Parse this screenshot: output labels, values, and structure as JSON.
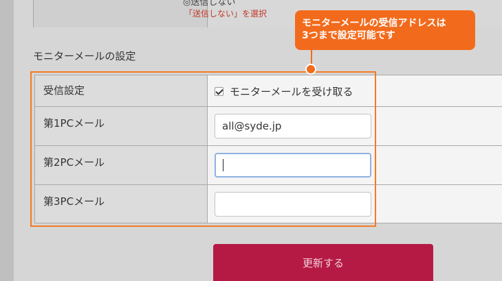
{
  "top_section": {
    "radio_text": "◎送信しない",
    "note": "「送信しない」を選択"
  },
  "section_title": "モニターメールの設定",
  "rows": [
    {
      "label": "受信設定",
      "checkbox_label": "モニターメールを受け取る",
      "checked": true
    },
    {
      "label": "第1PCメール",
      "value": "all@syde.jp",
      "placeholder": ""
    },
    {
      "label": "第2PCメール",
      "value": "",
      "placeholder": ""
    },
    {
      "label": "第3PCメール",
      "value": "",
      "placeholder": ""
    }
  ],
  "callout": {
    "line1": "モニターメールの受信アドレスは",
    "line2": "3つまで設定可能です"
  },
  "submit_label": "更新する",
  "colors": {
    "accent": "#f26b1d",
    "button": "#b51a45",
    "note": "#c0392b"
  }
}
